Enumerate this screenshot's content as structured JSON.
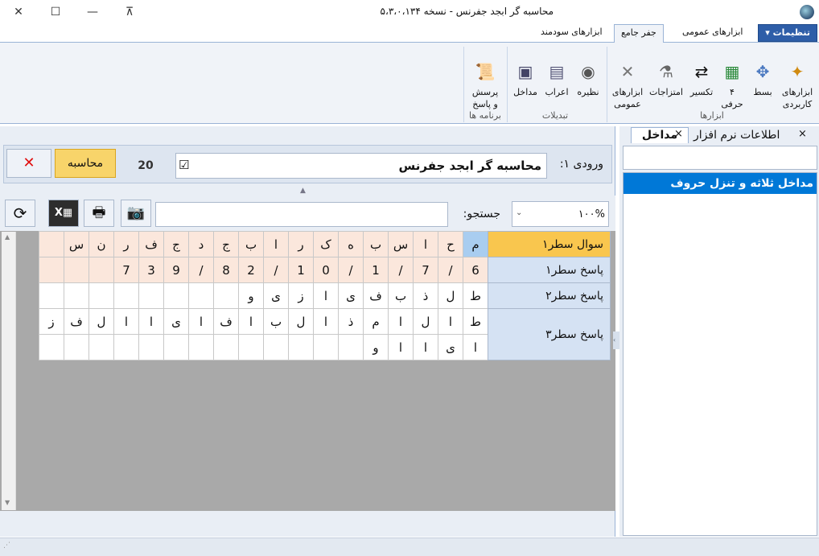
{
  "window": {
    "title": "محاسبه گر ابجد جفرنس - نسخه ۵،۳،۰،۱۳۴",
    "minimize": "—",
    "maximize": "☐",
    "restore": "⊼",
    "close": "✕"
  },
  "ribbon": {
    "tabs": [
      "ابزارهای سودمند",
      "جفر جامع",
      "ابزارهای عمومی",
      "تنظیمات ▾"
    ],
    "groups": {
      "tools": {
        "label": "ابزارها",
        "buttons": [
          "ابزارهای\nکاربردی",
          "بسط",
          "۴\nحرفی",
          "تکسیر",
          "امتزاجات",
          "ابزارهای\nعمومی"
        ]
      },
      "conversions": {
        "label": "تبدیلات",
        "buttons": [
          "نظیره",
          "اعراب",
          "مداخل"
        ]
      },
      "programs": {
        "label": "برنامه ها",
        "buttons": [
          "پرسش\nو پاسخ"
        ]
      }
    }
  },
  "input_panel": {
    "label": "ورودی ۱:",
    "value": "محاسبه گر ابجد جفرنس",
    "checkbox_mark": "☑",
    "count": "20",
    "calc_button": "محاسبه",
    "clear_button": "✕"
  },
  "toolbar": {
    "zoom": "۱۰۰%",
    "search_label": "جستجو:",
    "search_placeholder": ""
  },
  "grid": {
    "rows": [
      {
        "label": "سوال سطر۱",
        "cells": [
          "م",
          "ح",
          "ا",
          "س",
          "ب",
          "ه",
          "ک",
          "ر",
          "ا",
          "ب",
          "ج",
          "د",
          "ج",
          "ف",
          "ر",
          "ن",
          "س"
        ]
      },
      {
        "label": "پاسخ سطر۱",
        "cells": [
          "6",
          "/",
          "7",
          "/",
          "1",
          "/",
          "0",
          "1",
          "/",
          "2",
          "8",
          "/",
          "9",
          "3",
          "7"
        ]
      },
      {
        "label": "پاسخ سطر۲",
        "cells": [
          "ط",
          "ل",
          "ذ",
          "ب",
          "ف",
          "ی",
          "ا",
          "ز",
          "ی",
          "و"
        ]
      },
      {
        "label": "پاسخ سطر۳",
        "cells": [
          "ط",
          "ا",
          "ل",
          "ا",
          "م",
          "ذ",
          "ا",
          "ل",
          "ب",
          "ا",
          "ف",
          "ا",
          "ی",
          "ا",
          "ا",
          "ل",
          "ف",
          "ز"
        ]
      },
      {
        "label": "",
        "cells": [
          "ا",
          "ی",
          "ا",
          "ا",
          "و"
        ]
      }
    ]
  },
  "right_panel": {
    "tabs": [
      "اطلاعات نرم افزار",
      "مداخل"
    ],
    "close_icon": "×",
    "items": [
      "مداخل ثلاثه و تنزل حروف"
    ]
  },
  "colors": {
    "accent": "#0078d7",
    "selected_header": "#f9c64e",
    "first_cell": "#a9cdf0",
    "peach_rows": "#fbe7dc"
  }
}
